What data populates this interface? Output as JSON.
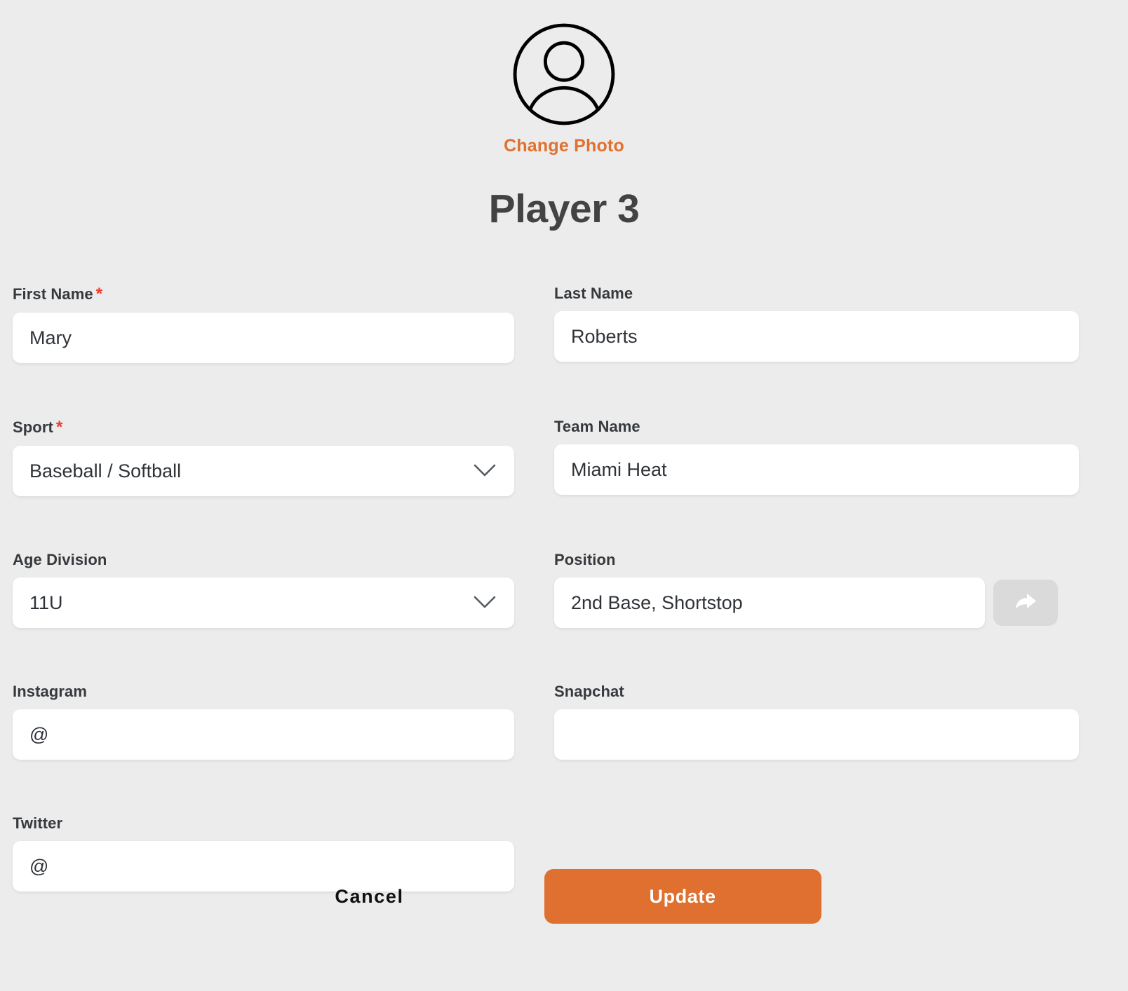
{
  "header": {
    "avatar_icon": "user-avatar-icon",
    "change_photo_label": "Change Photo",
    "title": "Player 3"
  },
  "form": {
    "required_marker": "*",
    "fields": {
      "first_name": {
        "label": "First Name",
        "required": true,
        "value": "Mary",
        "type": "text"
      },
      "last_name": {
        "label": "Last Name",
        "required": false,
        "value": "Roberts",
        "type": "text"
      },
      "sport": {
        "label": "Sport",
        "required": true,
        "value": "Baseball / Softball",
        "type": "select",
        "icon": "chevron-down-icon"
      },
      "team_name": {
        "label": "Team Name",
        "required": false,
        "value": "Miami Heat",
        "type": "text"
      },
      "age_division": {
        "label": "Age Division",
        "required": false,
        "value": "11U",
        "type": "select",
        "icon": "chevron-down-icon"
      },
      "position": {
        "label": "Position",
        "required": false,
        "value": "2nd Base, Shortstop",
        "type": "text",
        "action_icon": "share-arrow-icon"
      },
      "instagram": {
        "label": "Instagram",
        "required": false,
        "value": "@",
        "type": "text"
      },
      "snapchat": {
        "label": "Snapchat",
        "required": false,
        "value": "",
        "type": "text"
      },
      "twitter": {
        "label": "Twitter",
        "required": false,
        "value": "@",
        "type": "text"
      }
    }
  },
  "footer": {
    "cancel_label": "Cancel",
    "update_label": "Update"
  },
  "colors": {
    "accent_orange": "#df702f",
    "required_red": "#ee3b2b",
    "page_background": "#ececec",
    "field_background": "#ffffff",
    "text_dark": "#36393d",
    "share_button_gray": "#dadada"
  }
}
